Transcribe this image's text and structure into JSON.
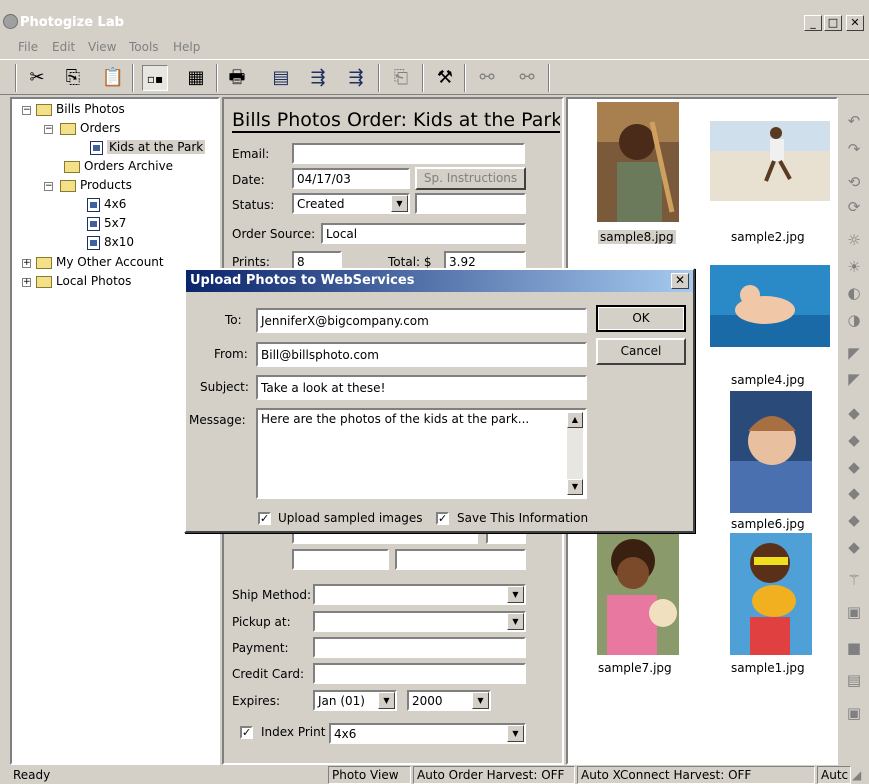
{
  "window": {
    "title": "Photogize Lab"
  },
  "menu": [
    "File",
    "Edit",
    "View",
    "Tools",
    "Help"
  ],
  "tree": {
    "root": "Bills Photos",
    "orders": "Orders",
    "kids": "Kids at the Park",
    "archive": "Orders Archive",
    "products": "Products",
    "p1": "4x6",
    "p2": "5x7",
    "p3": "8x10",
    "other": "My Other Account",
    "local": "Local Photos"
  },
  "form": {
    "title": "Bills Photos Order: Kids at the Park",
    "email_label": "Email:",
    "email_value": "",
    "date_label": "Date:",
    "date_value": "04/17/03",
    "sp_button": "Sp. Instructions",
    "status_label": "Status:",
    "status_value": "Created",
    "order_source_label": "Order Source:",
    "order_source_value": "Local",
    "prints_label": "Prints:",
    "prints_value": "8",
    "total_label": "Total: $",
    "total_value": "3.92",
    "ship_label": "Ship Method:",
    "pickup_label": "Pickup at:",
    "payment_label": "Payment:",
    "credit_label": "Credit Card:",
    "expires_label": "Expires:",
    "expires_month": "Jan (01)",
    "expires_year": "2000",
    "index_print_label": "Index Print",
    "index_print_value": "4x6"
  },
  "gallery": [
    "sample8.jpg",
    "sample2.jpg",
    "sample4.jpg",
    "sample6.jpg",
    "sample7.jpg",
    "sample1.jpg"
  ],
  "dialog": {
    "title": "Upload Photos to WebServices",
    "to_label": "To:",
    "to_value": "JenniferX@bigcompany.com",
    "from_label": "From:",
    "from_value": "Bill@billsphoto.com",
    "subject_label": "Subject:",
    "subject_value": "Take a look at these!",
    "message_label": "Message:",
    "message_value": "Here are the photos of the kids at the park...",
    "ok": "OK",
    "cancel": "Cancel",
    "upload_sampled": "Upload sampled images",
    "save_info": "Save This Information"
  },
  "status": {
    "ready": "Ready",
    "view": "Photo View",
    "harvest": "Auto Order Harvest: OFF",
    "xconnect": "Auto XConnect Harvest: OFF",
    "auto": "Autc"
  }
}
